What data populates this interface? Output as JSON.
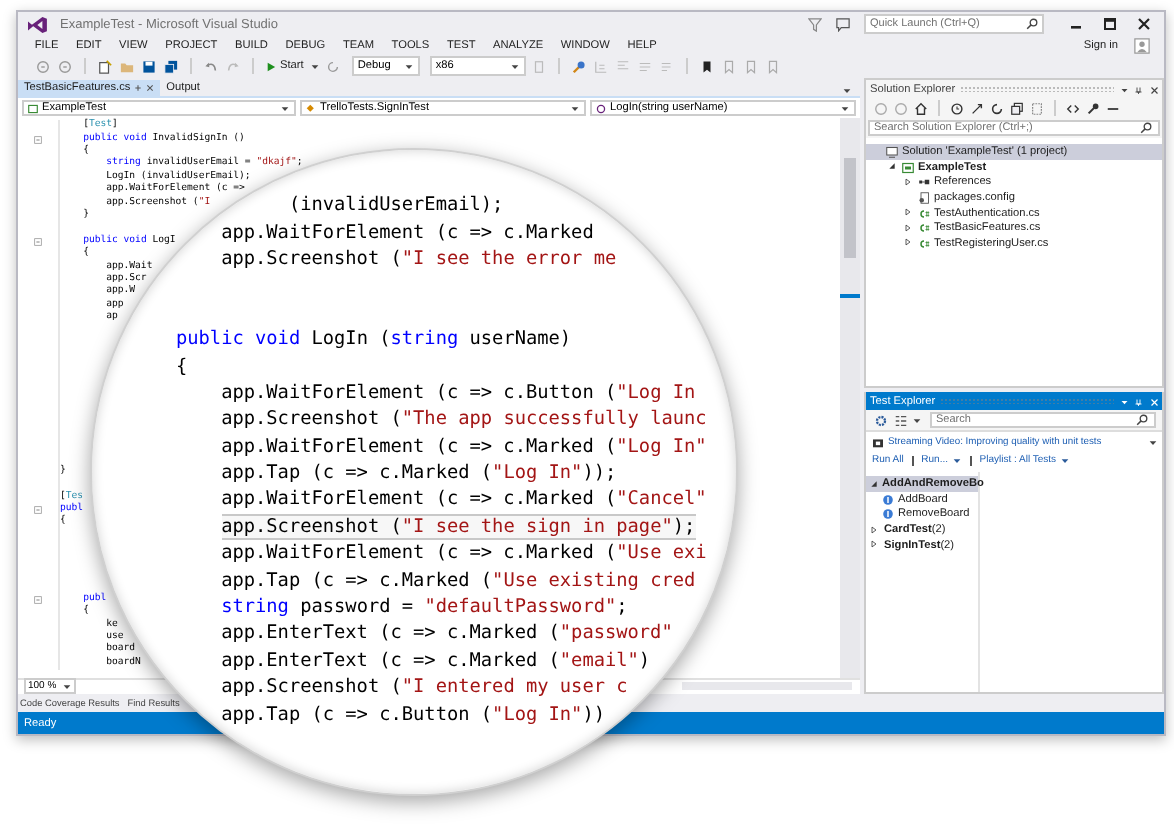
{
  "window": {
    "title": "ExampleTest - Microsoft Visual Studio"
  },
  "quick_launch": {
    "placeholder": "Quick Launch (Ctrl+Q)"
  },
  "menu": [
    "FILE",
    "EDIT",
    "VIEW",
    "PROJECT",
    "BUILD",
    "DEBUG",
    "TEAM",
    "TOOLS",
    "TEST",
    "ANALYZE",
    "WINDOW",
    "HELP"
  ],
  "account": {
    "label": "Sign in"
  },
  "toolbar": {
    "start": "Start",
    "configuration": "Debug",
    "platform": "x86"
  },
  "tabs": [
    {
      "label": "TestBasicFeatures.cs",
      "selected": true
    },
    {
      "label": "Output",
      "selected": false
    }
  ],
  "navigation": [
    "ExampleTest",
    "TrelloTests.SignInTest",
    "LogIn(string userName)"
  ],
  "code": [
    {
      "kind": "code",
      "collapsible": false,
      "segments": [
        {
          "text": "    [",
          "kind": "plain"
        },
        {
          "text": "Test",
          "kind": "type"
        },
        {
          "text": "]",
          "kind": "plain"
        }
      ]
    },
    {
      "kind": "code",
      "collapsible": true,
      "segments": [
        {
          "text": "    public void",
          "kind": "keyword"
        },
        {
          "text": " InvalidSignIn ()",
          "kind": "plain"
        }
      ]
    },
    {
      "kind": "code",
      "collapsible": false,
      "segments": [
        {
          "text": "    {",
          "kind": "plain"
        }
      ]
    },
    {
      "kind": "code",
      "collapsible": false,
      "segments": [
        {
          "text": "        string",
          "kind": "keyword"
        },
        {
          "text": " invalidUserEmail = ",
          "kind": "plain"
        },
        {
          "text": "\"dkajf\"",
          "kind": "string"
        },
        {
          "text": ";",
          "kind": "plain"
        }
      ]
    },
    {
      "kind": "code",
      "collapsible": false,
      "segments": [
        {
          "text": "        LogIn (invalidUserEmail);",
          "kind": "plain"
        }
      ]
    },
    {
      "kind": "code",
      "collapsible": false,
      "segments": [
        {
          "text": "        app.WaitForElement (c =>",
          "kind": "plain"
        }
      ]
    },
    {
      "kind": "code",
      "collapsible": false,
      "segments": [
        {
          "text": "        app.Screenshot (",
          "kind": "plain"
        },
        {
          "text": "\"I",
          "kind": "string"
        }
      ]
    },
    {
      "kind": "code",
      "collapsible": false,
      "segments": [
        {
          "text": "    }",
          "kind": "plain"
        }
      ]
    },
    {
      "kind": "blank"
    },
    {
      "kind": "code",
      "collapsible": true,
      "segments": [
        {
          "text": "    public void",
          "kind": "keyword"
        },
        {
          "text": " LogI",
          "kind": "plain"
        }
      ]
    },
    {
      "kind": "code",
      "collapsible": false,
      "segments": [
        {
          "text": "    {",
          "kind": "plain"
        }
      ]
    },
    {
      "kind": "code",
      "collapsible": false,
      "segments": [
        {
          "text": "        app.Wait",
          "kind": "plain"
        }
      ]
    },
    {
      "kind": "code",
      "collapsible": false,
      "segments": [
        {
          "text": "        app.Scr",
          "kind": "plain"
        }
      ]
    },
    {
      "kind": "code",
      "collapsible": false,
      "segments": [
        {
          "text": "        app.W",
          "kind": "plain"
        }
      ]
    },
    {
      "kind": "code",
      "collapsible": false,
      "segments": [
        {
          "text": "        app",
          "kind": "plain"
        }
      ]
    },
    {
      "kind": "code",
      "collapsible": false,
      "segments": [
        {
          "text": "        ap",
          "kind": "plain"
        }
      ]
    },
    {
      "kind": "blank"
    },
    {
      "kind": "blank"
    },
    {
      "kind": "blank"
    },
    {
      "kind": "blank"
    },
    {
      "kind": "blank"
    },
    {
      "kind": "blank"
    },
    {
      "kind": "blank"
    },
    {
      "kind": "blank"
    },
    {
      "kind": "blank"
    },
    {
      "kind": "blank"
    },
    {
      "kind": "blank"
    },
    {
      "kind": "code",
      "collapsible": false,
      "segments": [
        {
          "text": "}",
          "kind": "plain"
        }
      ]
    },
    {
      "kind": "blank"
    },
    {
      "kind": "code",
      "collapsible": false,
      "segments": [
        {
          "text": "[",
          "kind": "plain"
        },
        {
          "text": "Tes",
          "kind": "type"
        }
      ]
    },
    {
      "kind": "code",
      "collapsible": true,
      "segments": [
        {
          "text": "publ",
          "kind": "keyword"
        }
      ]
    },
    {
      "kind": "code",
      "collapsible": false,
      "segments": [
        {
          "text": "{",
          "kind": "plain"
        }
      ]
    },
    {
      "kind": "blank"
    },
    {
      "kind": "blank"
    },
    {
      "kind": "blank"
    },
    {
      "kind": "blank"
    },
    {
      "kind": "blank"
    },
    {
      "kind": "code",
      "collapsible": true,
      "segments": [
        {
          "text": "    publ",
          "kind": "keyword"
        }
      ]
    },
    {
      "kind": "code",
      "collapsible": false,
      "segments": [
        {
          "text": "    {",
          "kind": "plain"
        }
      ]
    },
    {
      "kind": "code",
      "collapsible": false,
      "segments": [
        {
          "text": "        ke",
          "kind": "plain"
        }
      ]
    },
    {
      "kind": "code",
      "collapsible": false,
      "segments": [
        {
          "text": "        use",
          "kind": "plain"
        }
      ]
    },
    {
      "kind": "code",
      "collapsible": false,
      "segments": [
        {
          "text": "        board",
          "kind": "plain"
        }
      ]
    },
    {
      "kind": "code",
      "collapsible": false,
      "segments": [
        {
          "text": "        boardN",
          "kind": "plain"
        }
      ]
    }
  ],
  "magnifier": {
    "lines": [
      {
        "kind": "code",
        "highlighted": false,
        "segments": [
          {
            "text": "          (invalidUserEmail);",
            "kind": "plain"
          }
        ]
      },
      {
        "kind": "code",
        "highlighted": false,
        "segments": [
          {
            "text": "    app.WaitForElement (c => c.Marked",
            "kind": "plain"
          }
        ]
      },
      {
        "kind": "code",
        "highlighted": false,
        "segments": [
          {
            "text": "    app.Screenshot (",
            "kind": "plain"
          },
          {
            "text": "\"I see the error me",
            "kind": "string"
          }
        ]
      },
      {
        "kind": "blank"
      },
      {
        "kind": "blank"
      },
      {
        "kind": "code",
        "highlighted": false,
        "segments": [
          {
            "text": "public void",
            "kind": "keyword"
          },
          {
            "text": " LogIn (",
            "kind": "plain"
          },
          {
            "text": "string",
            "kind": "keyword"
          },
          {
            "text": " userName)",
            "kind": "plain"
          }
        ]
      },
      {
        "kind": "code",
        "highlighted": false,
        "segments": [
          {
            "text": "{",
            "kind": "plain"
          }
        ]
      },
      {
        "kind": "code",
        "highlighted": false,
        "segments": [
          {
            "text": "    app.WaitForElement (c => c.Button (",
            "kind": "plain"
          },
          {
            "text": "\"Log In",
            "kind": "string"
          }
        ]
      },
      {
        "kind": "code",
        "highlighted": false,
        "segments": [
          {
            "text": "    app.Screenshot (",
            "kind": "plain"
          },
          {
            "text": "\"The app successfully launc",
            "kind": "string"
          }
        ]
      },
      {
        "kind": "code",
        "highlighted": false,
        "segments": [
          {
            "text": "    app.WaitForElement (c => c.Marked (",
            "kind": "plain"
          },
          {
            "text": "\"Log In\"",
            "kind": "string"
          }
        ]
      },
      {
        "kind": "code",
        "highlighted": false,
        "segments": [
          {
            "text": "    app.Tap (c => c.Marked (",
            "kind": "plain"
          },
          {
            "text": "\"Log In\"",
            "kind": "string"
          },
          {
            "text": "));",
            "kind": "plain"
          }
        ]
      },
      {
        "kind": "code",
        "highlighted": false,
        "segments": [
          {
            "text": "    app.WaitForElement (c => c.Marked (",
            "kind": "plain"
          },
          {
            "text": "\"Cancel\"",
            "kind": "string"
          }
        ]
      },
      {
        "kind": "code",
        "highlighted": true,
        "segments": [
          {
            "text": "    app.Screenshot (",
            "kind": "plain"
          },
          {
            "text": "\"I see the sign in page\"",
            "kind": "string"
          },
          {
            "text": ");",
            "kind": "plain"
          }
        ]
      },
      {
        "kind": "code",
        "highlighted": false,
        "segments": [
          {
            "text": "    app.WaitForElement (c => c.Marked (",
            "kind": "plain"
          },
          {
            "text": "\"Use exi",
            "kind": "string"
          }
        ]
      },
      {
        "kind": "code",
        "highlighted": false,
        "segments": [
          {
            "text": "    app.Tap (c => c.Marked (",
            "kind": "plain"
          },
          {
            "text": "\"Use existing cred",
            "kind": "string"
          }
        ]
      },
      {
        "kind": "code",
        "highlighted": false,
        "segments": [
          {
            "text": "    string",
            "kind": "keyword"
          },
          {
            "text": " password = ",
            "kind": "plain"
          },
          {
            "text": "\"defaultPassword\"",
            "kind": "string"
          },
          {
            "text": ";",
            "kind": "plain"
          }
        ]
      },
      {
        "kind": "code",
        "highlighted": false,
        "segments": [
          {
            "text": "    app.EnterText (c => c.Marked (",
            "kind": "plain"
          },
          {
            "text": "\"password\"",
            "kind": "string"
          }
        ]
      },
      {
        "kind": "code",
        "highlighted": false,
        "segments": [
          {
            "text": "    app.EnterText (c => c.Marked (",
            "kind": "plain"
          },
          {
            "text": "\"email\"",
            "kind": "string"
          },
          {
            "text": ")",
            "kind": "plain"
          }
        ]
      },
      {
        "kind": "code",
        "highlighted": false,
        "segments": [
          {
            "text": "    app.Screenshot (",
            "kind": "plain"
          },
          {
            "text": "\"I entered my user c",
            "kind": "string"
          }
        ]
      },
      {
        "kind": "code",
        "highlighted": false,
        "segments": [
          {
            "text": "    app.Tap (c => c.Button (",
            "kind": "plain"
          },
          {
            "text": "\"Log In\"",
            "kind": "string"
          },
          {
            "text": "))",
            "kind": "plain"
          }
        ]
      }
    ]
  },
  "zoom": "100 %",
  "bottom_tabs": [
    "Code Coverage Results",
    "Find Results"
  ],
  "status_bar": "Ready",
  "solution_explorer": {
    "title": "Solution Explorer",
    "search": {
      "placeholder": "Search Solution Explorer (Ctrl+;)"
    },
    "items": [
      {
        "label": "Solution 'ExampleTest' (1 project)",
        "kind": "solution",
        "selected": true,
        "children": [
          {
            "label": "ExampleTest",
            "kind": "project",
            "selected": false,
            "expanded": true,
            "children": [
              {
                "label": "References",
                "kind": "references",
                "selected": false,
                "expanded": false
              },
              {
                "label": "packages.config",
                "kind": "config",
                "selected": false
              },
              {
                "label": "TestAuthentication.cs",
                "kind": "csharp",
                "selected": false,
                "expanded": false
              },
              {
                "label": "TestBasicFeatures.cs",
                "kind": "csharp",
                "selected": false,
                "expanded": false
              },
              {
                "label": "TestRegisteringUser.cs",
                "kind": "csharp",
                "selected": false,
                "expanded": false
              }
            ]
          }
        ]
      }
    ]
  },
  "test_explorer": {
    "title": "Test Explorer",
    "search": {
      "placeholder": "Search"
    },
    "notice": "Streaming Video: Improving quality with unit tests",
    "actions": [
      "Run All",
      "Run...",
      "Playlist : All Tests"
    ],
    "tests": [
      {
        "label": "AddAndRemoveBo",
        "kind": "group",
        "selected": true,
        "expanded": true,
        "children": [
          {
            "label": "AddBoard",
            "kind": "test",
            "selected": false
          },
          {
            "label": "RemoveBoard",
            "kind": "test",
            "selected": false
          }
        ]
      },
      {
        "label": "CardTest",
        "count": "(2)",
        "kind": "group",
        "selected": false,
        "expanded": false
      },
      {
        "label": "SignInTest",
        "count": "(2)",
        "kind": "group",
        "selected": false,
        "expanded": false
      }
    ]
  }
}
